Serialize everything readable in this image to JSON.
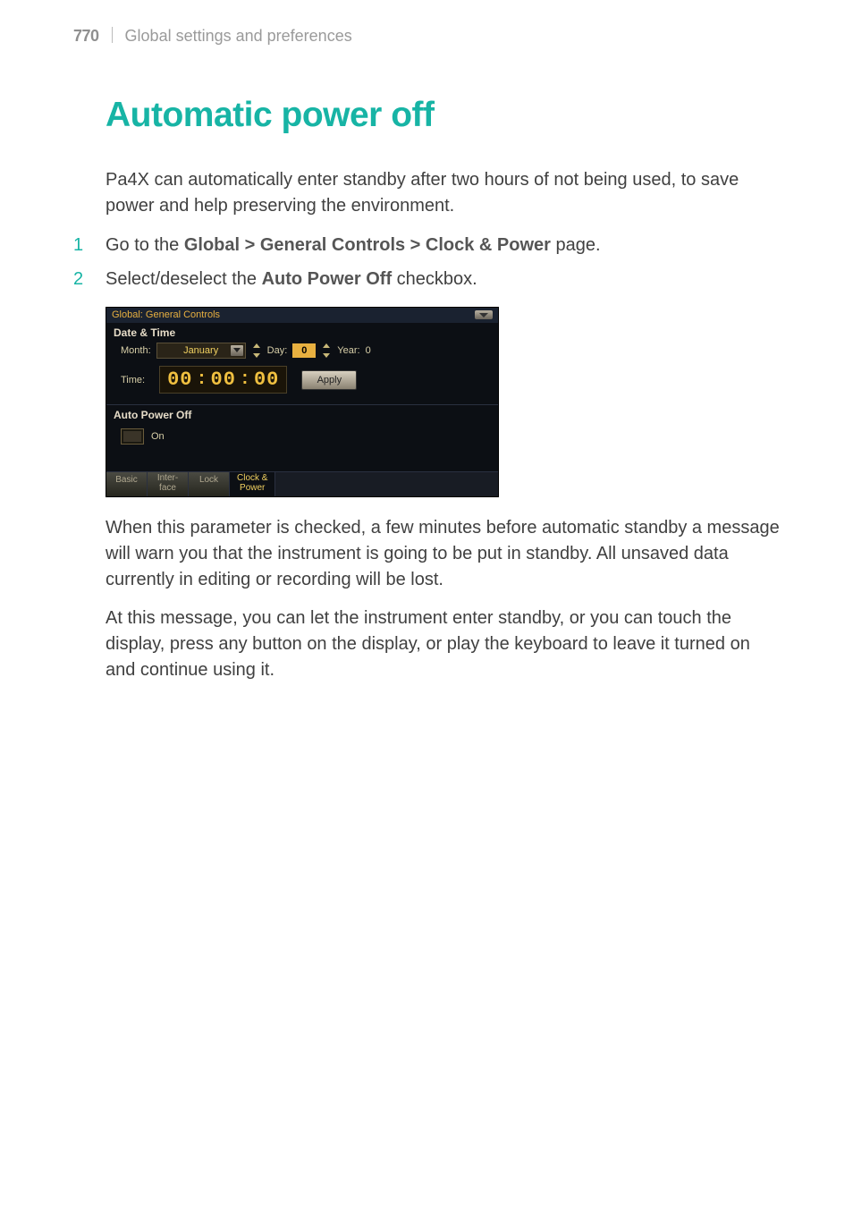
{
  "header": {
    "page_number": "770",
    "section_title": "Global settings and preferences"
  },
  "title": "Automatic power off",
  "intro": "Pa4X can automatically enter standby after two hours of not being used, to save power and help preserving the environment.",
  "steps": [
    {
      "num": "1",
      "pre": "Go to the ",
      "path": "Global > General Controls > Clock & Power",
      "post": " page."
    },
    {
      "num": "2",
      "pre": "Select/deselect the ",
      "path": "Auto Power Off",
      "post": " checkbox."
    }
  ],
  "screenshot": {
    "title": "Global: General Controls",
    "date_time_label": "Date & Time",
    "month_label": "Month:",
    "month_value": "January",
    "day_label": "Day:",
    "day_value": "0",
    "year_label": "Year:",
    "year_value": "0",
    "time_label": "Time:",
    "time_h": "00",
    "time_m": "00",
    "time_s": "00",
    "time_colon": ":",
    "apply_label": "Apply",
    "auto_power_label": "Auto Power Off",
    "on_label": "On",
    "tabs": {
      "basic": "Basic",
      "interface_l1": "Inter-",
      "interface_l2": "face",
      "lock": "Lock",
      "clock_l1": "Clock &",
      "clock_l2": "Power"
    }
  },
  "para2": "When this parameter is checked, a few minutes before automatic standby a message will warn you that the instrument is going to be put in standby. All unsaved data currently in editing or recording will be lost.",
  "para3": "At this message, you can let the instrument enter standby, or you can touch the display, press any button on the display, or play the keyboard to leave it turned on and continue using it."
}
